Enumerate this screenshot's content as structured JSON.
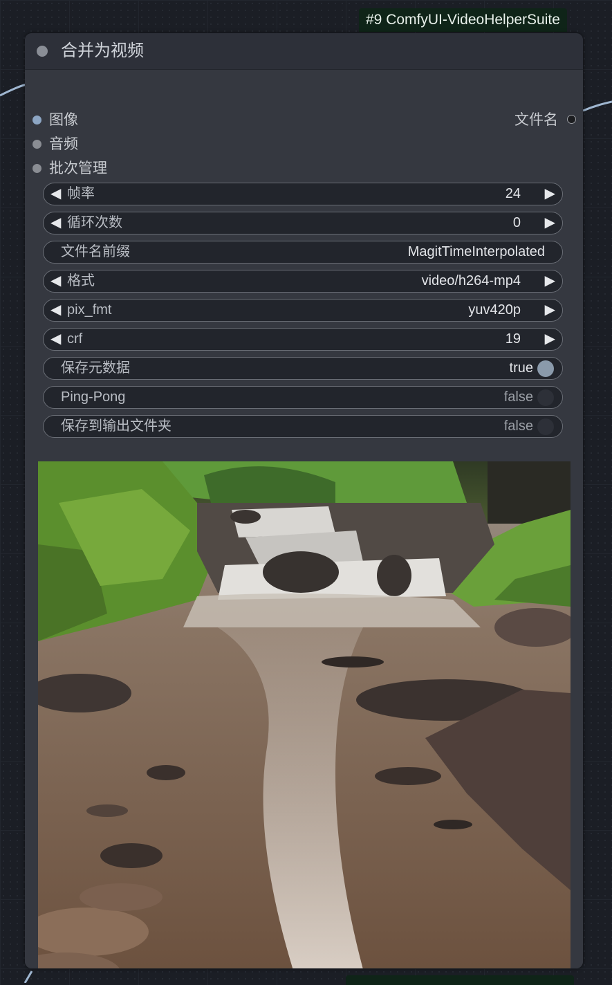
{
  "badge": {
    "text": "#9 ComfyUI-VideoHelperSuite"
  },
  "node": {
    "title": "合并为视频",
    "inputs": [
      {
        "label": "图像",
        "color": "#8da6c4"
      },
      {
        "label": "音频",
        "color": "#8a8d93"
      },
      {
        "label": "批次管理",
        "color": "#8a8d93"
      }
    ],
    "output": {
      "label": "文件名",
      "color": "#1c1d20"
    },
    "widgets": {
      "frame_rate": {
        "label": "帧率",
        "value": "24"
      },
      "loop_count": {
        "label": "循环次数",
        "value": "0"
      },
      "filename_prefix": {
        "label": "文件名前缀",
        "value": "MagitTimeInterpolated"
      },
      "format": {
        "label": "格式",
        "value": "video/h264-mp4"
      },
      "pix_fmt": {
        "label": "pix_fmt",
        "value": "yuv420p"
      },
      "crf": {
        "label": "crf",
        "value": "19"
      },
      "save_metadata": {
        "label": "保存元数据",
        "value": "true"
      },
      "pingpong": {
        "label": "Ping-Pong",
        "value": "false"
      },
      "save_output": {
        "label": "保存到输出文件夹",
        "value": "false"
      }
    },
    "arrows": {
      "left": "◀",
      "right": "▶"
    }
  },
  "preview": {
    "subject": "river-waterfall-landscape"
  },
  "colors": {
    "wire": "#9fb6d0",
    "toggle_on": "#8a9aab",
    "toggle_off": "#2d3038",
    "badge_bg": "#0f2418"
  }
}
